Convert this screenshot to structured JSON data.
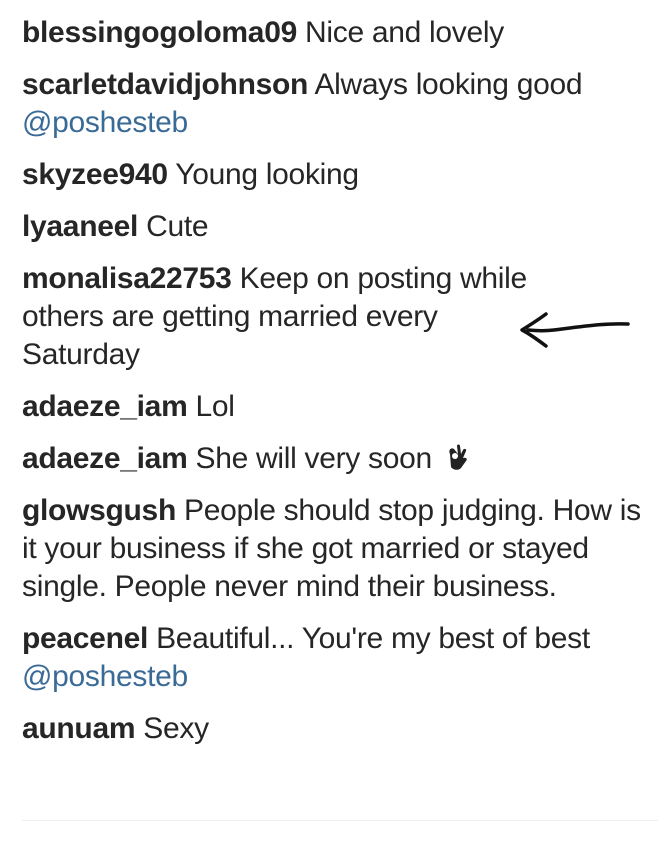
{
  "comments": [
    {
      "username": "blessingogoloma09",
      "text": "Nice and lovely"
    },
    {
      "username": "scarletdavidjohnson",
      "text": "Always looking good",
      "mention": "@poshesteb"
    },
    {
      "username": "skyzee940",
      "text": "Young looking"
    },
    {
      "username": "lyaaneel",
      "text": "Cute"
    },
    {
      "username": "monalisa22753",
      "text": "Keep on posting while others are getting married every Saturday"
    },
    {
      "username": "adaeze_iam",
      "text": "Lol"
    },
    {
      "username": "adaeze_iam",
      "text": "She will very soon",
      "icon": "ok-hand-icon"
    },
    {
      "username": "glowsgush",
      "text": "People should stop judging. How is it your business if she got married or stayed single. People never mind their business."
    },
    {
      "username": "peacenel",
      "text": "Beautiful... You're my best of best",
      "mention": "@poshesteb"
    },
    {
      "username": "aunuam",
      "text": "Sexy"
    }
  ],
  "colors": {
    "text": "#262626",
    "mention": "#3a6a96"
  }
}
